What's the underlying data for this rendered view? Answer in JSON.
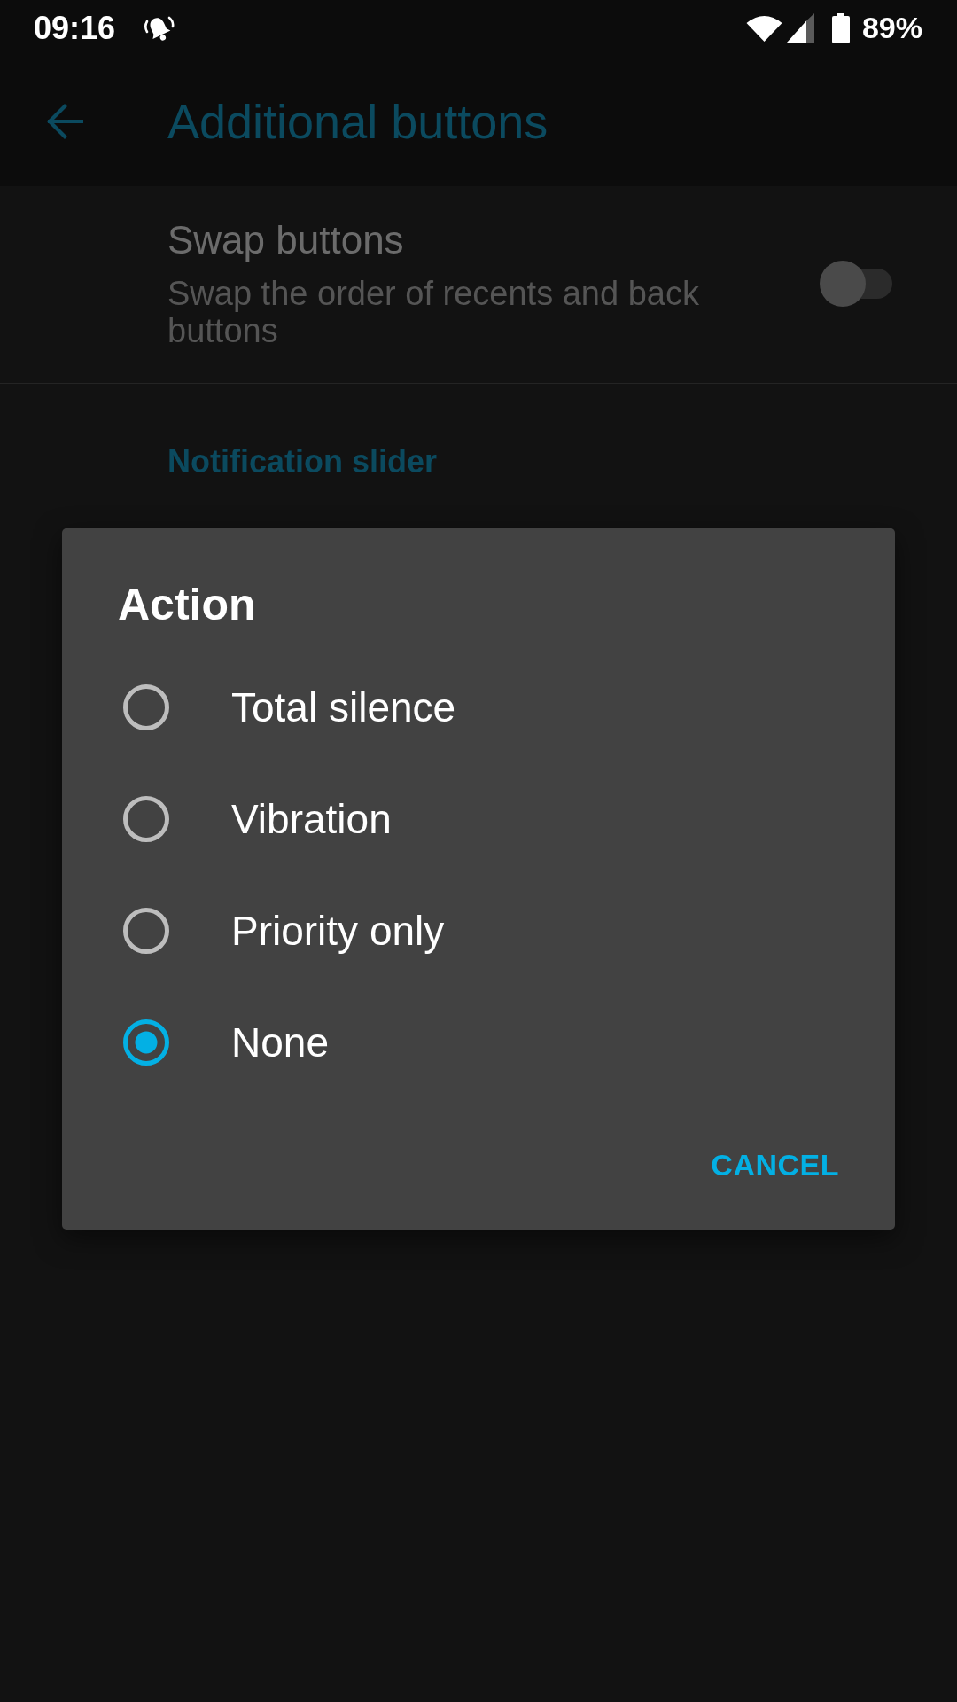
{
  "status_bar": {
    "time": "09:16",
    "battery_percent": "89%"
  },
  "toolbar": {
    "title": "Additional buttons"
  },
  "settings": [
    {
      "kind": "switch",
      "title": "Swap buttons",
      "summary": "Swap the order of recents and back buttons",
      "on": false
    },
    {
      "kind": "header",
      "title": "Notification slider"
    }
  ],
  "dialog": {
    "title": "Action",
    "options": [
      {
        "label": "Total silence",
        "selected": false
      },
      {
        "label": "Vibration",
        "selected": false
      },
      {
        "label": "Priority only",
        "selected": false
      },
      {
        "label": "None",
        "selected": true
      }
    ],
    "buttons": [
      "CANCEL"
    ]
  }
}
